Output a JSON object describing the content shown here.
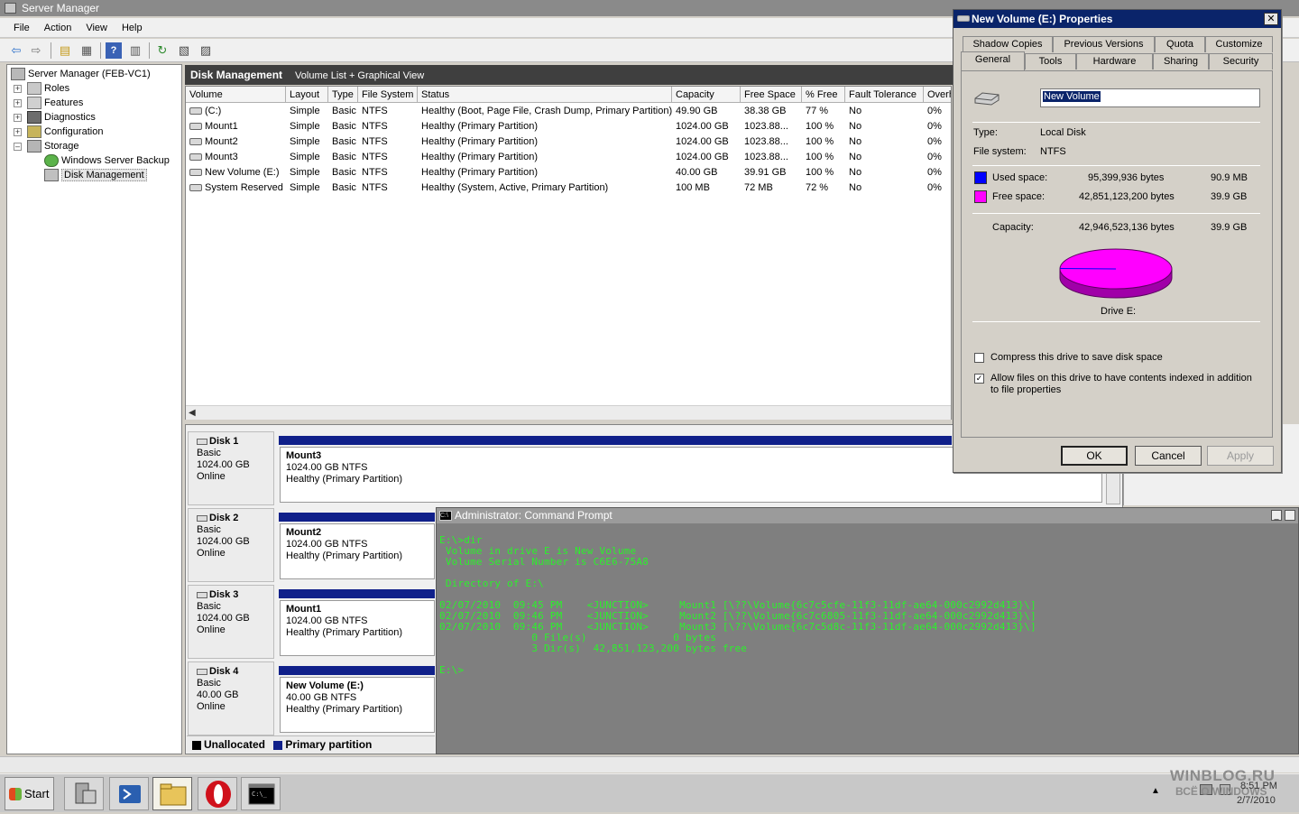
{
  "server_manager": {
    "title": "Server Manager",
    "menu": [
      "File",
      "Action",
      "View",
      "Help"
    ],
    "tree": {
      "root": "Server Manager (FEB-VC1)",
      "items": [
        "Roles",
        "Features",
        "Diagnostics",
        "Configuration",
        "Storage"
      ],
      "storage_children": [
        "Windows Server Backup",
        "Disk Management"
      ]
    },
    "center_header": {
      "title": "Disk Management",
      "view": "Volume List + Graphical View"
    },
    "columns": [
      "Volume",
      "Layout",
      "Type",
      "File System",
      "Status",
      "Capacity",
      "Free Space",
      "% Free",
      "Fault Tolerance",
      "Overh"
    ],
    "volumes": [
      {
        "volume": "(C:)",
        "layout": "Simple",
        "type": "Basic",
        "fs": "NTFS",
        "status": "Healthy (Boot, Page File, Crash Dump, Primary Partition)",
        "capacity": "49.90 GB",
        "free": "38.38 GB",
        "pct": "77 %",
        "fault": "No",
        "overhead": "0%"
      },
      {
        "volume": "Mount1",
        "layout": "Simple",
        "type": "Basic",
        "fs": "NTFS",
        "status": "Healthy (Primary Partition)",
        "capacity": "1024.00 GB",
        "free": "1023.88...",
        "pct": "100 %",
        "fault": "No",
        "overhead": "0%"
      },
      {
        "volume": "Mount2",
        "layout": "Simple",
        "type": "Basic",
        "fs": "NTFS",
        "status": "Healthy (Primary Partition)",
        "capacity": "1024.00 GB",
        "free": "1023.88...",
        "pct": "100 %",
        "fault": "No",
        "overhead": "0%"
      },
      {
        "volume": "Mount3",
        "layout": "Simple",
        "type": "Basic",
        "fs": "NTFS",
        "status": "Healthy (Primary Partition)",
        "capacity": "1024.00 GB",
        "free": "1023.88...",
        "pct": "100 %",
        "fault": "No",
        "overhead": "0%"
      },
      {
        "volume": "New Volume (E:)",
        "layout": "Simple",
        "type": "Basic",
        "fs": "NTFS",
        "status": "Healthy (Primary Partition)",
        "capacity": "40.00 GB",
        "free": "39.91 GB",
        "pct": "100 %",
        "fault": "No",
        "overhead": "0%"
      },
      {
        "volume": "System Reserved",
        "layout": "Simple",
        "type": "Basic",
        "fs": "NTFS",
        "status": "Healthy (System, Active, Primary Partition)",
        "capacity": "100 MB",
        "free": "72 MB",
        "pct": "72 %",
        "fault": "No",
        "overhead": "0%"
      }
    ],
    "disks": [
      {
        "name": "Disk 1",
        "type": "Basic",
        "size": "1024.00 GB",
        "state": "Online",
        "part_name": "Mount3",
        "part_size": "1024.00 GB NTFS",
        "part_status": "Healthy (Primary Partition)"
      },
      {
        "name": "Disk 2",
        "type": "Basic",
        "size": "1024.00 GB",
        "state": "Online",
        "part_name": "Mount2",
        "part_size": "1024.00 GB NTFS",
        "part_status": "Healthy (Primary Partition)"
      },
      {
        "name": "Disk 3",
        "type": "Basic",
        "size": "1024.00 GB",
        "state": "Online",
        "part_name": "Mount1",
        "part_size": "1024.00 GB NTFS",
        "part_status": "Healthy (Primary Partition)"
      },
      {
        "name": "Disk 4",
        "type": "Basic",
        "size": "40.00 GB",
        "state": "Online",
        "part_name": "New Volume  (E:)",
        "part_size": "40.00 GB NTFS",
        "part_status": "Healthy (Primary Partition)"
      }
    ],
    "legend": {
      "unallocated": "Unallocated",
      "primary": "Primary partition",
      "unallocated_color": "#000000",
      "primary_color": "#10208a"
    }
  },
  "cmd": {
    "title": "Administrator: Command Prompt",
    "text_color": "#2cf02c",
    "lines": [
      "E:\\>dir",
      " Volume in drive E is New Volume",
      " Volume Serial Number is C6E6-75A8",
      "",
      " Directory of E:\\",
      "",
      "02/07/2010  09:45 PM    <JUNCTION>     Mount1 [\\??\\Volume{6c7c5cfe-11f3-11df-ae64-000c2992d413}\\]",
      "02/07/2010  09:46 PM    <JUNCTION>     Mount2 [\\??\\Volume{6c7c6805-11f3-11df-ae64-000c2992d413}\\]",
      "02/07/2010  09:46 PM    <JUNCTION>     Mount3 [\\??\\Volume{6c7c5d8c-11f3-11df-ae64-000c2992d413}\\]",
      "               0 File(s)              0 bytes",
      "               3 Dir(s)  42,851,123,200 bytes free",
      "",
      "E:\\>"
    ]
  },
  "properties": {
    "title": "New Volume (E:) Properties",
    "tabs_row1": [
      "Shadow Copies",
      "Previous Versions",
      "Quota",
      "Customize"
    ],
    "tabs_row2": [
      "General",
      "Tools",
      "Hardware",
      "Sharing",
      "Security"
    ],
    "active_tab": "General",
    "volume_name": "New Volume",
    "type_label": "Type:",
    "type_value": "Local Disk",
    "fs_label": "File system:",
    "fs_value": "NTFS",
    "used_label": "Used space:",
    "used_bytes": "95,399,936 bytes",
    "used_human": "90.9 MB",
    "used_color": "#0000ff",
    "free_label": "Free space:",
    "free_bytes": "42,851,123,200 bytes",
    "free_human": "39.9 GB",
    "free_color": "#ff00ff",
    "capacity_label": "Capacity:",
    "capacity_bytes": "42,946,523,136 bytes",
    "capacity_human": "39.9 GB",
    "drive_label": "Drive E:",
    "compress_label": "Compress this drive to save disk space",
    "compress_checked": false,
    "index_label": "Allow files on this drive to have contents indexed in addition to file properties",
    "index_checked": true,
    "buttons": {
      "ok": "OK",
      "cancel": "Cancel",
      "apply": "Apply"
    }
  },
  "taskbar": {
    "start": "Start",
    "time": "8:51 PM",
    "date": "2/7/2010",
    "watermark": "WINBLOG.RU",
    "watermark_sub": "ВСЁ О WINDOWS"
  }
}
